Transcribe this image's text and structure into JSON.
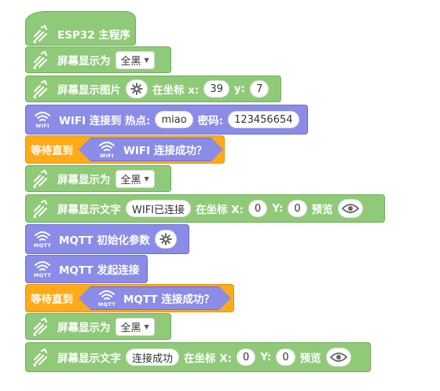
{
  "blocks": {
    "start": {
      "label": "ESP32 主程序"
    },
    "fill1": {
      "label": "屏幕显示为",
      "dropdown": "全黑"
    },
    "image": {
      "label": "屏幕显示图片",
      "at": "在坐标 x:",
      "x": "39",
      "y_label": "y:",
      "y": "7"
    },
    "wifi_connect": {
      "label": "WIFI 连接到 热点:",
      "ssid": "miao",
      "pwd_label": "密码:",
      "password": "123456654",
      "icon_text": "WIFI"
    },
    "wait_wifi": {
      "label": "等待直到",
      "cond": "WIFI 连接成功？",
      "icon_text": "WIFI"
    },
    "fill2": {
      "label": "屏幕显示为",
      "dropdown": "全黑"
    },
    "text1": {
      "label": "屏幕显示文字",
      "text": "WIFI已连接",
      "at": "在坐标 X:",
      "x": "0",
      "y_label": "Y:",
      "y": "0",
      "preview": "预览"
    },
    "mqtt_init": {
      "label": "MQTT 初始化参数",
      "icon_text": "MQTT"
    },
    "mqtt_connect": {
      "label": "MQTT 发起连接",
      "icon_text": "MQTT"
    },
    "wait_mqtt": {
      "label": "等待直到",
      "cond": "MQTT 连接成功？",
      "icon_text": "MQTT"
    },
    "fill3": {
      "label": "屏幕显示为",
      "dropdown": "全黑"
    },
    "text2": {
      "label": "屏幕显示文字",
      "text": "连接成功",
      "at": "在坐标 X:",
      "x": "0",
      "y_label": "Y:",
      "y": "0",
      "preview": "预览"
    }
  },
  "colors": {
    "green": "#8fca78",
    "blue": "#8a8ce8",
    "orange": "#ffab19"
  },
  "icons": [
    "gesture-icon",
    "wifi-icon",
    "gear-icon",
    "eye-icon"
  ]
}
